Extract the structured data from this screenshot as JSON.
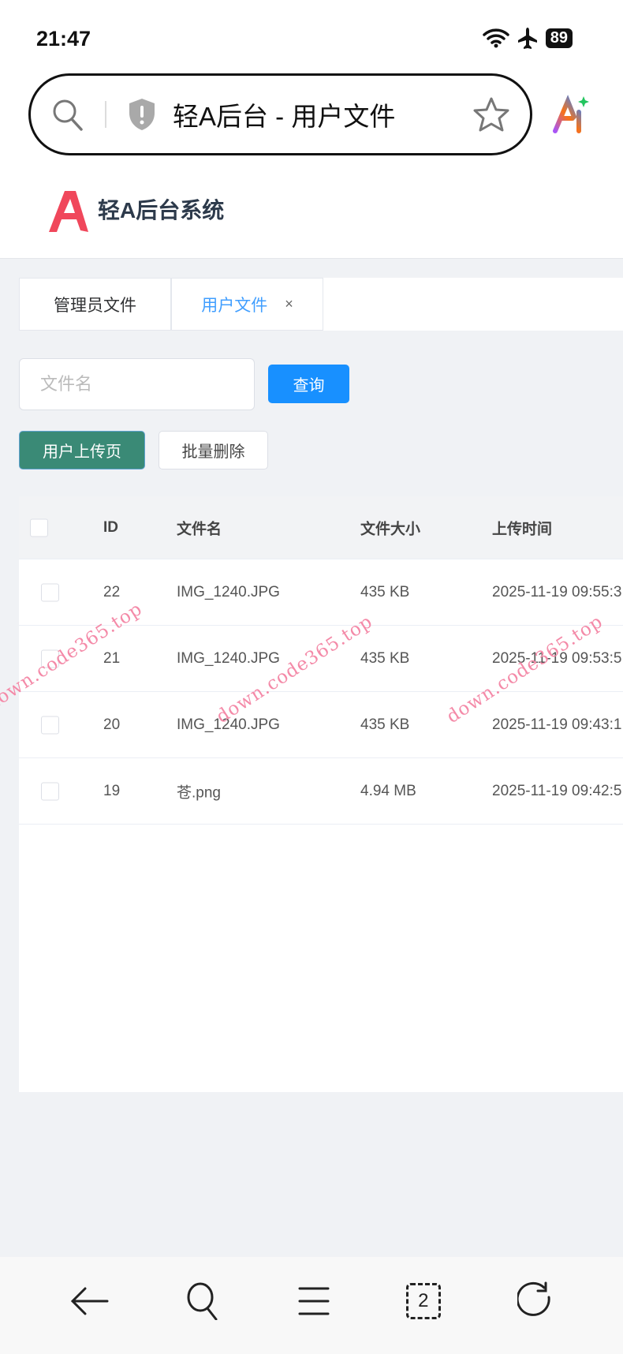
{
  "status_bar": {
    "time": "21:47",
    "battery": "89"
  },
  "browser": {
    "url_title": "轻A后台 - 用户文件"
  },
  "app": {
    "brand": "轻A后台系统",
    "accent": "#409eff"
  },
  "tabs": [
    {
      "label": "管理员文件",
      "active": false
    },
    {
      "label": "用户文件",
      "active": true,
      "close": "×"
    }
  ],
  "search": {
    "placeholder": "文件名",
    "value": "",
    "query_label": "查询"
  },
  "actions": {
    "upload_label": "用户上传页",
    "delete_label": "批量删除"
  },
  "table": {
    "headers": [
      "ID",
      "文件名",
      "文件大小",
      "上传时间"
    ],
    "rows": [
      {
        "id": "22",
        "name": "IMG_1240.JPG",
        "size": "435 KB",
        "time": "2025-11-19 09:55:3"
      },
      {
        "id": "21",
        "name": "IMG_1240.JPG",
        "size": "435 KB",
        "time": "2025-11-19 09:53:5"
      },
      {
        "id": "20",
        "name": "IMG_1240.JPG",
        "size": "435 KB",
        "time": "2025-11-19 09:43:1"
      },
      {
        "id": "19",
        "name": "苍.png",
        "size": "4.94 MB",
        "time": "2025-11-19 09:42:5"
      }
    ]
  },
  "watermark": "down.code365.top",
  "bottom_bar": {
    "tab_count": "2"
  }
}
